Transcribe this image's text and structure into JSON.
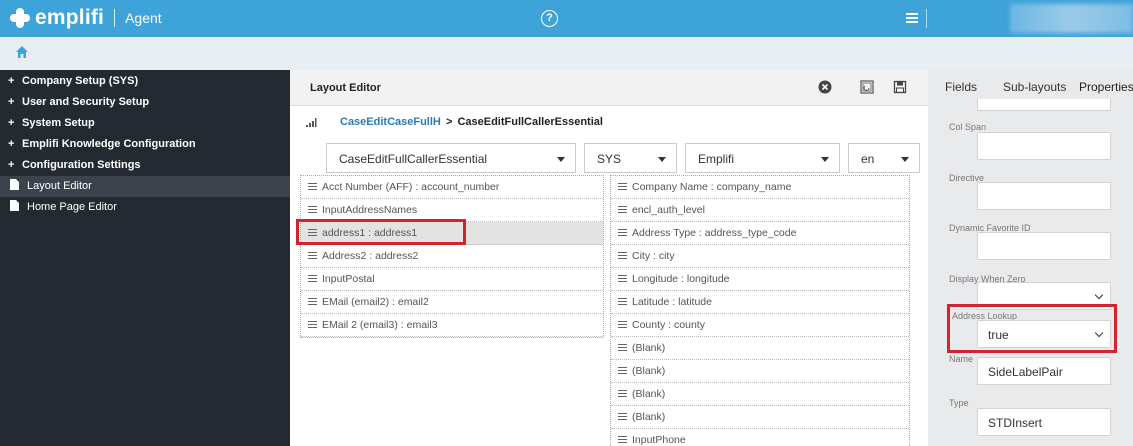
{
  "app": {
    "brand": "emplifi",
    "product": "Agent",
    "help_glyph": "?"
  },
  "sidebar": {
    "items": [
      {
        "label": "Company Setup (SYS)",
        "prefix": "+"
      },
      {
        "label": "User and Security Setup",
        "prefix": "+"
      },
      {
        "label": "System Setup",
        "prefix": "+"
      },
      {
        "label": "Emplifi Knowledge Configuration",
        "prefix": "+"
      },
      {
        "label": "Configuration Settings",
        "prefix": "+"
      },
      {
        "label": "Layout Editor",
        "icon": "file-icon",
        "active": true
      },
      {
        "label": "Home Page Editor",
        "icon": "file-icon"
      }
    ]
  },
  "editor": {
    "title": "Layout Editor",
    "breadcrumb": {
      "link": "CaseEditCaseFullH",
      "separator": ">",
      "current": "CaseEditFullCallerEssential"
    },
    "selects": {
      "layout": "CaseEditFullCallerEssential",
      "scope": "SYS",
      "company": "Emplifi",
      "language": "en"
    },
    "left_column": [
      "Acct Number (AFF) : account_number",
      "InputAddressNames",
      "address1 : address1",
      "Address2 : address2",
      "InputPostal",
      "EMail (email2) : email2",
      "EMail 2 (email3) : email3"
    ],
    "right_column": [
      "Company Name : company_name",
      "encl_auth_level",
      "Address Type : address_type_code",
      "City : city",
      "Longitude : longitude",
      "Latitude : latitude",
      "County : county",
      "(Blank)",
      "(Blank)",
      "(Blank)",
      "(Blank)",
      "InputPhone"
    ]
  },
  "props": {
    "tabs": [
      "Fields",
      "Sub-layouts",
      "Properties"
    ],
    "fields": {
      "col_span": {
        "label": "Col Span",
        "value": ""
      },
      "directive": {
        "label": "Directive",
        "value": ""
      },
      "dynamic_favorite_id": {
        "label": "Dynamic Favorite ID",
        "value": ""
      },
      "display_when_zero": {
        "label": "Display When Zero",
        "value": ""
      },
      "address_lookup": {
        "label": "Address Lookup",
        "value": "true"
      },
      "name": {
        "label": "Name",
        "value": "SideLabelPair"
      },
      "type": {
        "label": "Type",
        "value": "STDInsert"
      }
    }
  },
  "colors": {
    "brand": "#3ea3d9",
    "sidebar": "#242a31",
    "highlight": "#d1242f",
    "link": "#2b7ab8"
  }
}
